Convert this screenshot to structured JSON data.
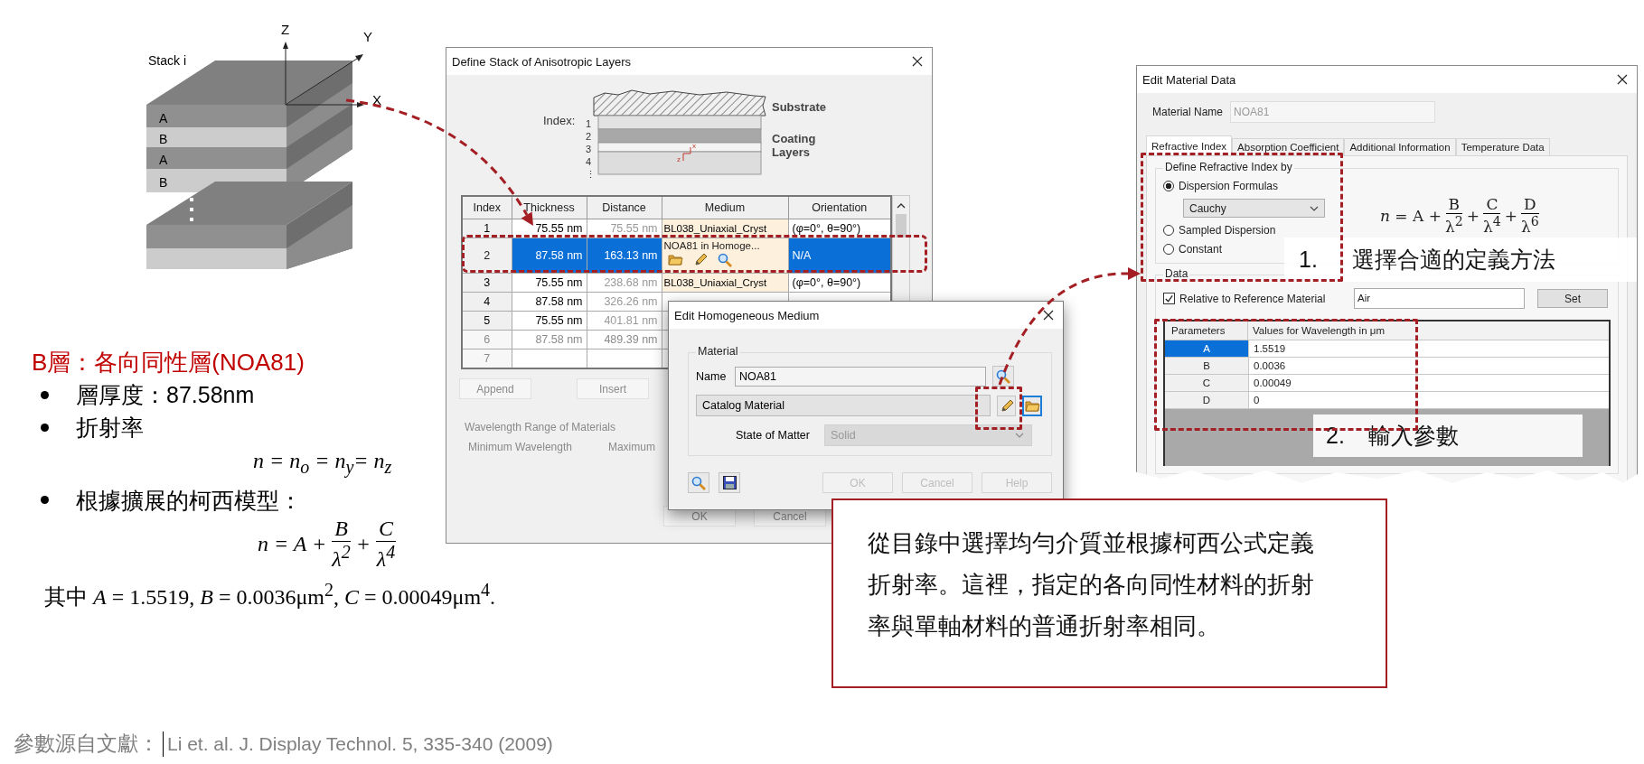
{
  "stack_diagram": {
    "title": "Stack i",
    "axes": [
      {
        "kind": "z",
        "label": "Z"
      },
      {
        "kind": "y",
        "label": "Y"
      },
      {
        "kind": "x",
        "label": "X"
      }
    ],
    "layers": [
      "A",
      "B",
      "A",
      "B"
    ]
  },
  "stack_dialog": {
    "title": "Define Stack of Anisotropic Layers",
    "sketch": {
      "index_label": "Index:",
      "indices": [
        "1",
        "2",
        "3",
        "4",
        "⋮"
      ],
      "substrate_label": "Substrate",
      "coating_label": [
        "Coating",
        "Layers"
      ],
      "axis_labels": [
        "x",
        "z"
      ]
    },
    "columns": [
      "Index",
      "Thickness",
      "Distance",
      "Medium",
      "Orientation"
    ],
    "rows": [
      {
        "index": "1",
        "thickness": "75.55 nm",
        "distance": "75.55 nm",
        "medium": "BL038_Uniaxial_Cryst",
        "orientation": "(φ=0°, θ=90°)",
        "selected": false,
        "faded": false
      },
      {
        "index": "2",
        "thickness": "87.58 nm",
        "distance": "163.13 nm",
        "medium": "NOA81  in Homoge...",
        "orientation": "N/A",
        "selected": true,
        "faded": false
      },
      {
        "index": "3",
        "thickness": "75.55 nm",
        "distance": "238.68 nm",
        "medium": "BL038_Uniaxial_Cryst",
        "orientation": "(φ=0°, θ=90°)",
        "selected": false,
        "faded": false
      },
      {
        "index": "4",
        "thickness": "87.58 nm",
        "distance": "326.26 nm",
        "selected": false,
        "faded": false
      },
      {
        "index": "5",
        "thickness": "75.55 nm",
        "distance": "401.81 nm",
        "selected": false,
        "faded": false
      },
      {
        "index": "6",
        "thickness": "87.58 nm",
        "distance": "489.39 nm",
        "selected": false,
        "faded": true
      },
      {
        "index": "7",
        "selected": false,
        "faded": true
      }
    ],
    "buttons": [
      "Append",
      "Insert"
    ],
    "wavelength_group": {
      "title": "Wavelength Range of Materials",
      "labels": [
        "Minimum Wavelength",
        "Maximum"
      ]
    },
    "footer_buttons": [
      "OK",
      "Cancel"
    ]
  },
  "medium_dialog": {
    "title": "Edit Homogeneous Medium",
    "group": "Material",
    "name_label": "Name",
    "name_value": "NOA81",
    "source": "Catalog Material",
    "state_label": "State of Matter",
    "state_value": "Solid",
    "state_disabled": true,
    "buttons": [
      "OK",
      "Cancel",
      "Help"
    ]
  },
  "material_dialog": {
    "title": "Edit Material Data",
    "name_label": "Material Name",
    "name_value": "NOA81",
    "tabs": [
      {
        "label": "Refractive Index",
        "selected": true
      },
      {
        "label": "Absorption Coefficient",
        "selected": false
      },
      {
        "label": "Additional Information",
        "selected": false
      },
      {
        "label": "Temperature Data",
        "selected": false
      }
    ],
    "define_group": {
      "title": "Define Refractive Index by",
      "options": [
        {
          "label": "Dispersion Formulas",
          "selected": true
        },
        {
          "label": "Sampled Dispersion",
          "selected": false
        },
        {
          "label": "Constant",
          "selected": false
        }
      ],
      "formula_choice": "Cauchy"
    },
    "formula": {
      "lhs": "*n* = A +",
      "terms": [
        {
          "numerator": "B",
          "denominator": "λ$^{2}$"
        },
        {
          "prefix": "+",
          "numerator": "C",
          "denominator": "λ$^{4}$"
        },
        {
          "prefix": "+",
          "numerator": "D",
          "denominator": "λ$^{6}$"
        }
      ]
    },
    "data_group": {
      "title": "Data",
      "reference_label": "Relative to Reference Material",
      "reference_checked": true,
      "reference_value": "Air",
      "set_button": "Set"
    },
    "parameters": {
      "columns": [
        "Parameters",
        "Values for Wavelength in μm"
      ],
      "rows": [
        {
          "name": "A",
          "value": "1.5519",
          "selected": true
        },
        {
          "name": "B",
          "value": "0.0036",
          "selected": false
        },
        {
          "name": "C",
          "value": "0.00049",
          "selected": false
        },
        {
          "name": "D",
          "value": "0",
          "selected": false
        }
      ]
    },
    "callouts": [
      {
        "number": "1.",
        "text": "選擇合適的定義方法"
      },
      {
        "number": "2.",
        "text": "輸入參數"
      }
    ]
  },
  "left_notes": [
    {
      "kind": "heading",
      "text": "B層：各向同性層(NOA81)"
    },
    {
      "kind": "bullet",
      "text": "層厚度：87.58nm"
    },
    {
      "kind": "bullet",
      "text": "折射率"
    },
    {
      "kind": "equation",
      "text": "n = n$_{o}$ = n$_{y}$= n$_{z}$"
    },
    {
      "kind": "bullet",
      "text": "根據擴展的柯西模型："
    },
    {
      "kind": "fraction",
      "lhs": "n = A +",
      "terms": [
        {
          "numerator": "B",
          "denominator": "λ$^{2}$"
        },
        {
          "prefix": "+",
          "numerator": "C",
          "denominator": "λ$^{4}$"
        }
      ]
    },
    {
      "kind": "note",
      "text": "其中 *A* = 1.5519, *B* = 0.0036μm$^{2}$, *C* = 0.00049μm$^{4}$."
    }
  ],
  "explanation": "從目錄中選擇均勻介質並根據柯西公式定義折射率。這裡，指定的各向同性材料的折射率與單軸材料的普通折射率相同。",
  "footer": {
    "label": "參數源自文獻：",
    "citation": "Li et. al. J. Display Technol. 5, 335-340 (2009)"
  }
}
